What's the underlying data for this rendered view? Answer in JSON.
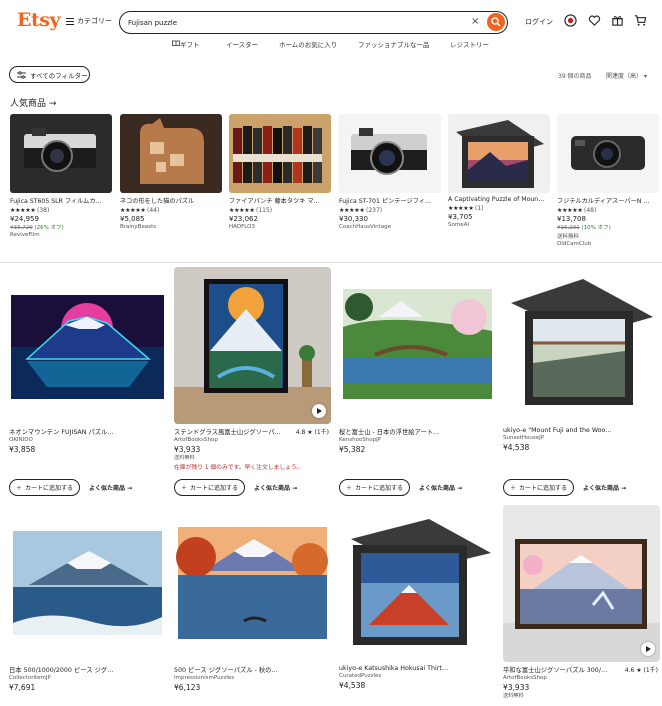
{
  "header": {
    "logo": "Etsy",
    "categories_label": "カテゴリー",
    "search_value": "Fujisan puzzle",
    "clear_glyph": "×",
    "login_label": "ログイン"
  },
  "subnav": [
    "ギフト",
    "イースター",
    "ホームのお気に入り",
    "ファッショナブルな一品",
    "レジストリー"
  ],
  "filters": {
    "all_label": "すべてのフィルター",
    "results": "39 個の商品",
    "sort": "関連度（高）"
  },
  "popular": {
    "title": "人気商品 →",
    "items": [
      {
        "title": "Fujica ST605 SLR フィルムカ…",
        "stars": "★★★★★",
        "count": "(38)",
        "price": "¥24,959",
        "orig": "¥33,729",
        "discount": " (26% オフ)",
        "shop": "ReviveFilm"
      },
      {
        "title": "ネコの形をした猫のパズル",
        "stars": "★★★★★",
        "count": "(44)",
        "price": "¥5,085",
        "orig": "",
        "discount": "",
        "shop": "BrainyBeasts"
      },
      {
        "title": "ファイアパンチ 藤本タツキ マ…",
        "stars": "★★★★★",
        "count": "(115)",
        "price": "¥23,062",
        "orig": "",
        "discount": "",
        "shop": "HADFLO3"
      },
      {
        "title": "Fujica ST-701 ピンテージフィ…",
        "stars": "★★★★★",
        "count": "(237)",
        "price": "¥30,330",
        "orig": "",
        "discount": "",
        "shop": "CoachHausVintage"
      },
      {
        "title": "A Captivating Puzzle of Moun…",
        "stars": "★★★★★",
        "count": "(1)",
        "price": "¥3,705",
        "orig": "",
        "discount": "",
        "shop": "SomeAI"
      },
      {
        "title": "フジテルカルディアスーパーN …",
        "stars": "★★★★★",
        "count": "(48)",
        "price": "¥13,708",
        "orig": "¥15,231",
        "discount": " (10% オフ)",
        "shop": "送料無料",
        "shop2": "OldCamClub"
      }
    ]
  },
  "grid": {
    "cart_label": "カートに追加する",
    "similar_label": "よく似た商品 →",
    "cards": [
      {
        "title": "ネオンマウンテン FUJISAN パズル…",
        "shop": "OKINIDO",
        "price": "¥3,858",
        "rating": "",
        "free": "",
        "note": ""
      },
      {
        "title": "ステンドグラス風富士山ジグソーパ…",
        "shop": "ArtofBooksShop",
        "price": "¥3,933",
        "rating": "4.8 ★ (1千)",
        "free": "送料無料",
        "note": "在庫が残り 1 個のみです。早く注文しましょう。"
      },
      {
        "title": "桜と富士山 - 日本の浮世絵アート…",
        "shop": "KenshooShopJP",
        "price": "¥5,382",
        "rating": "",
        "free": "",
        "note": ""
      },
      {
        "title": "ukiyo-e \"Mount Fuji and the Woo…",
        "shop": "SunsetHouseJP",
        "price": "¥4,538",
        "rating": "",
        "free": "",
        "note": ""
      },
      {
        "title": "日本 500/1000/2000 ピース ジグ…",
        "shop": "CollectoritemJP",
        "price": "¥7,691",
        "rating": "",
        "free": "",
        "note": ""
      },
      {
        "title": "500 ピース ジグソーパズル - 秋の…",
        "shop": "ImpressionismPuzzles",
        "price": "¥6,123",
        "rating": "",
        "free": "",
        "note": ""
      },
      {
        "title": "ukiyo-e Katsushika Hokusai Thirt…",
        "shop": "CuratedPuzzles",
        "price": "¥4,538",
        "rating": "",
        "free": "",
        "note": ""
      },
      {
        "title": "平和な富士山ジグソーパズル 300/…",
        "shop": "ArtofBooksShop",
        "price": "¥3,933",
        "rating": "4.6 ★ (1千)",
        "free": "送料無料",
        "note": ""
      }
    ]
  },
  "colors": {
    "accent": "#f1641e",
    "note": "#b42525",
    "discount": "#2a7a2a"
  },
  "icons": [
    "menu-icon",
    "search-icon",
    "clear-icon",
    "profile-icon",
    "heart-icon",
    "gift-icon",
    "cart-icon",
    "filter-icon",
    "plus-icon",
    "play-icon"
  ]
}
